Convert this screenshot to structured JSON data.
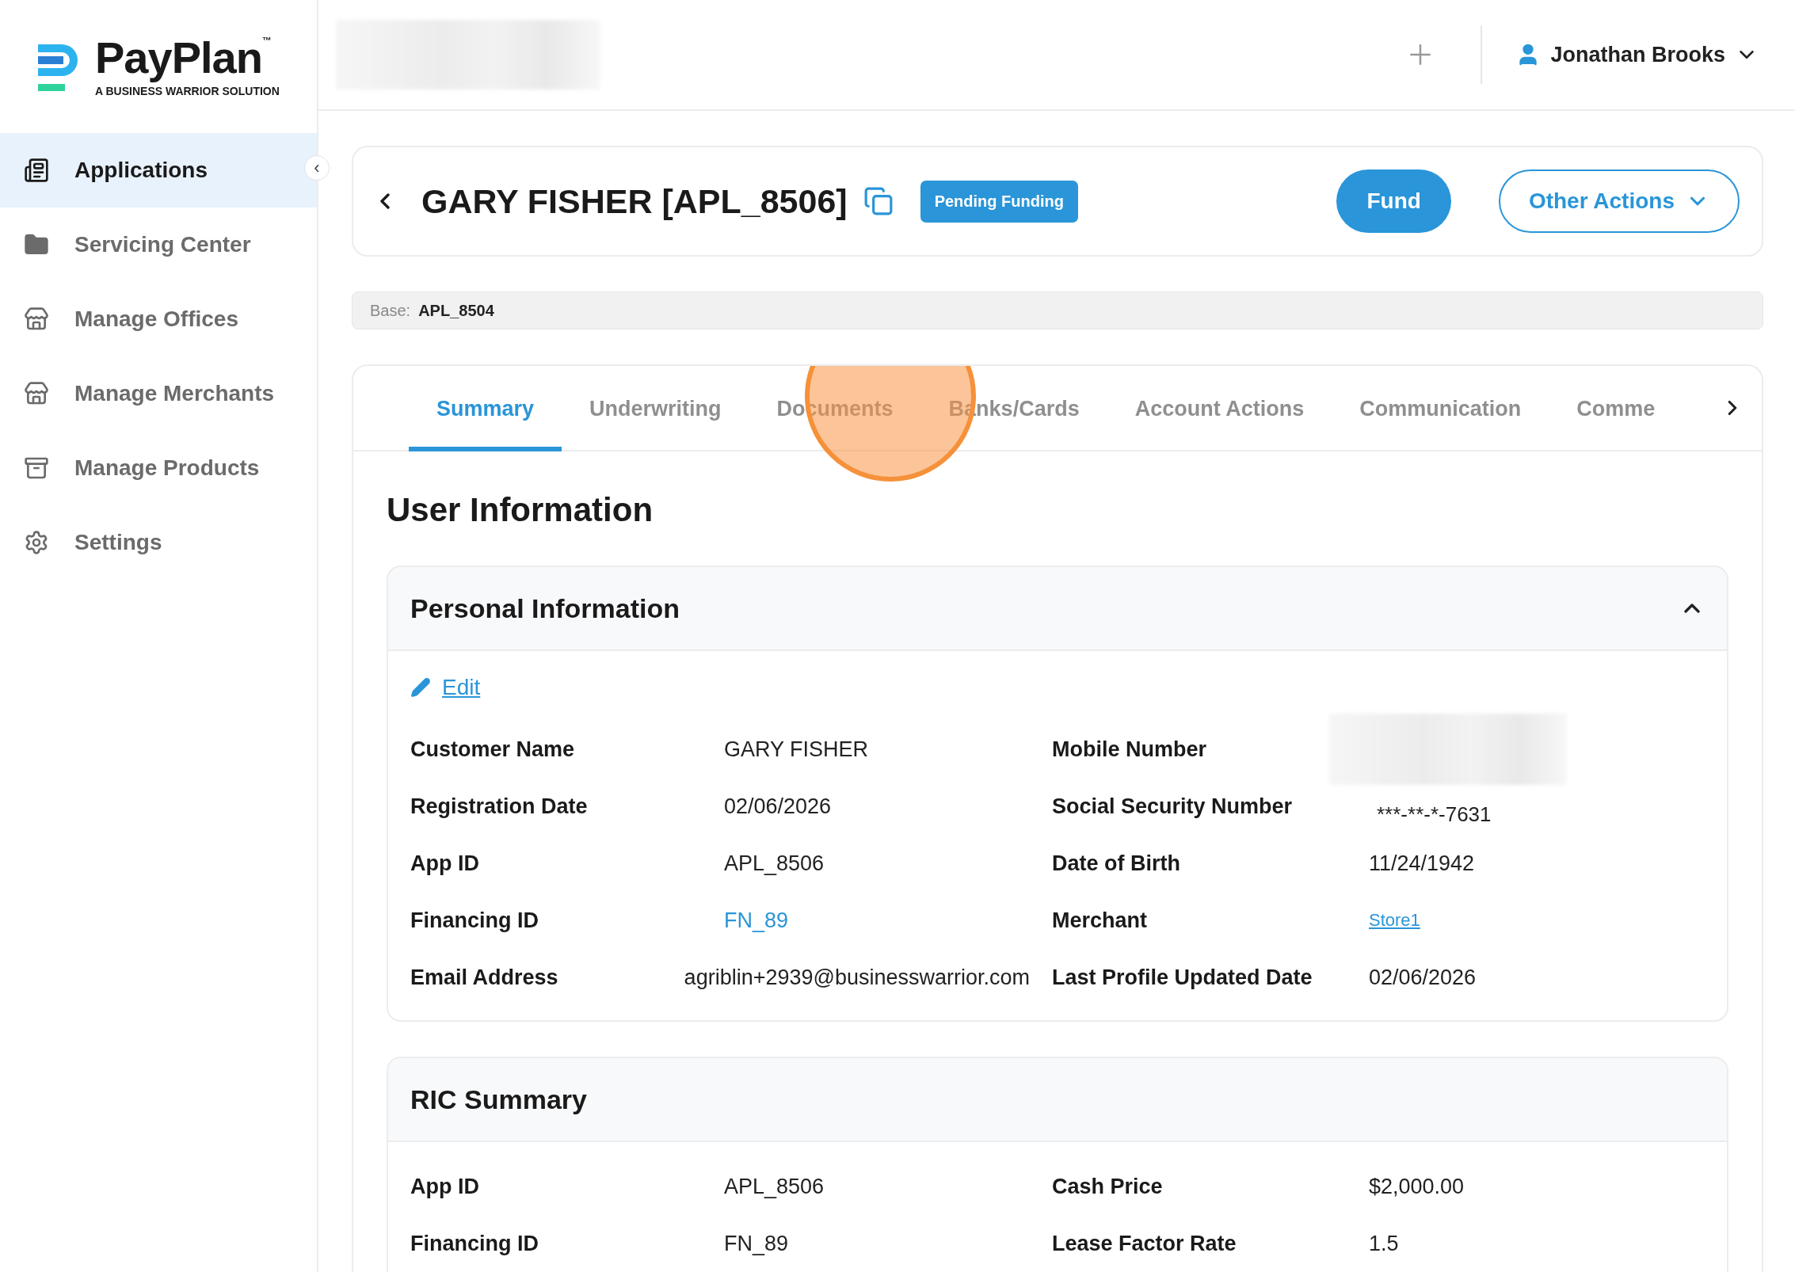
{
  "logo": {
    "name": "PayPlan",
    "trademark": "™",
    "tagline": "A BUSINESS WARRIOR SOLUTION"
  },
  "sidebar": {
    "items": [
      {
        "label": "Applications",
        "selected": true
      },
      {
        "label": "Servicing Center",
        "selected": false
      },
      {
        "label": "Manage Offices",
        "selected": false
      },
      {
        "label": "Manage Merchants",
        "selected": false
      },
      {
        "label": "Manage Products",
        "selected": false
      },
      {
        "label": "Settings",
        "selected": false
      }
    ],
    "collapse_button": "‹"
  },
  "header": {
    "user": "Jonathan Brooks"
  },
  "application": {
    "title": "GARY FISHER [APL_8506]",
    "status": "Pending Funding",
    "primary_action": "Fund",
    "secondary_action": "Other Actions",
    "base_label": "Base:",
    "base_value": "APL_8504"
  },
  "tabs": [
    {
      "label": "Summary",
      "selected": true
    },
    {
      "label": "Underwriting",
      "selected": false
    },
    {
      "label": "Documents",
      "selected": false
    },
    {
      "label": "Banks/Cards",
      "selected": false
    },
    {
      "label": "Account Actions",
      "selected": false
    },
    {
      "label": "Communication",
      "selected": false
    },
    {
      "label": "Comme",
      "selected": false
    }
  ],
  "section_title": "User Information",
  "personal": {
    "title": "Personal Information",
    "expanded": true,
    "edit": "Edit",
    "rows": [
      [
        {
          "label": "Customer Name",
          "value": "GARY FISHER",
          "kind": "text"
        },
        {
          "label": "Mobile Number",
          "kind": "redacted"
        }
      ],
      [
        {
          "label": "Registration Date",
          "value": "02/06/2026",
          "kind": "text"
        },
        {
          "label": "Social Security Number",
          "value": "***-**-*-7631",
          "kind": "masked"
        }
      ],
      [
        {
          "label": "App ID",
          "value": "APL_8506",
          "kind": "text"
        },
        {
          "label": "Date of Birth",
          "value": "11/24/1942",
          "kind": "text"
        }
      ],
      [
        {
          "label": "Financing ID",
          "value": "FN_89",
          "kind": "link"
        },
        {
          "label": "Merchant",
          "value": "Store1",
          "kind": "underlined"
        }
      ],
      [
        {
          "label": "Email Address",
          "value": "agriblin+2939@businesswarrior.com",
          "kind": "wide"
        },
        {
          "label": "Last Profile Updated Date",
          "value": "02/06/2026",
          "kind": "text"
        }
      ]
    ]
  },
  "ric": {
    "title": "RIC Summary",
    "rows": [
      [
        {
          "label": "App ID",
          "value": "APL_8506",
          "kind": "text"
        },
        {
          "label": "Cash Price",
          "value": "$2,000.00",
          "kind": "text"
        }
      ],
      [
        {
          "label": "Financing ID",
          "value": "FN_89",
          "kind": "text"
        },
        {
          "label": "Lease Factor Rate",
          "value": "1.5",
          "kind": "text"
        }
      ]
    ]
  }
}
